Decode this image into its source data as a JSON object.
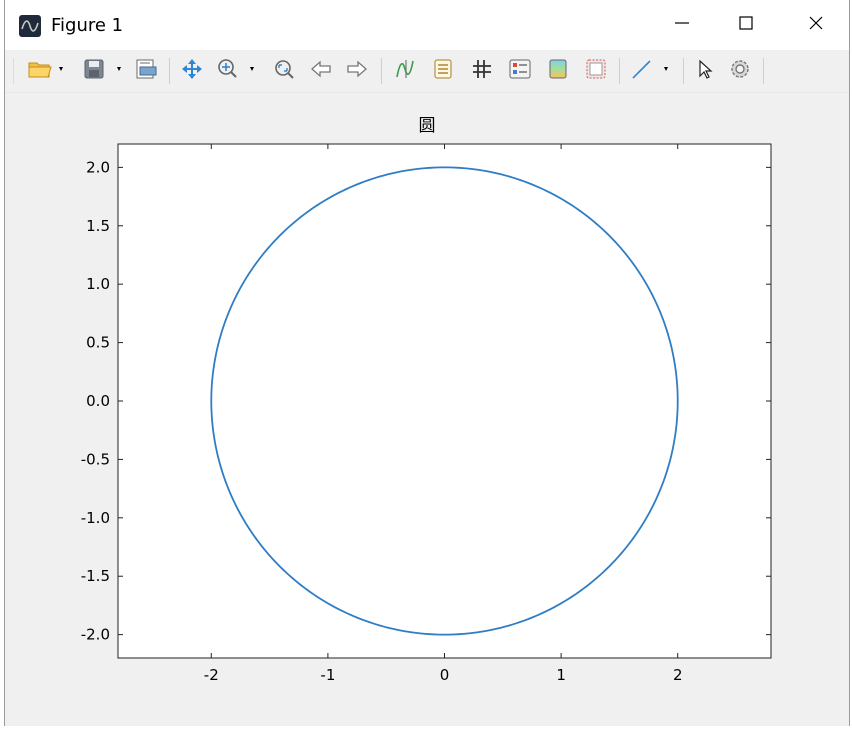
{
  "window": {
    "title": "Figure 1"
  },
  "window_controls": {
    "minimize": "minimize",
    "maximize": "maximize",
    "close": "close"
  },
  "toolbar": {
    "items": [
      "open",
      "save",
      "print-preview",
      "pan",
      "zoom-in",
      "zoom-fit",
      "back",
      "forward",
      "lines",
      "legend",
      "grid",
      "properties",
      "colorbar",
      "frame",
      "line-style",
      "select",
      "settings"
    ]
  },
  "colors": {
    "series": "#2f7dc4",
    "axes": "#000000"
  },
  "chart_data": {
    "type": "line",
    "title": "圆",
    "xlabel": "",
    "ylabel": "",
    "xlim": [
      -2.8,
      2.8
    ],
    "ylim": [
      -2.2,
      2.2
    ],
    "xticks": [
      -2,
      -1,
      0,
      1,
      2
    ],
    "xtick_labels": [
      "-2",
      "-1",
      "0",
      "1",
      "2"
    ],
    "yticks": [
      2.0,
      1.5,
      1.0,
      0.5,
      0.0,
      -0.5,
      -1.0,
      -1.5,
      -2.0
    ],
    "ytick_labels": [
      "2.0",
      "1.5",
      "1.0",
      "0.5",
      "0.0",
      "-0.5",
      "-1.0",
      "-1.5",
      "-2.0"
    ],
    "grid": false,
    "series": [
      {
        "shape": "circle",
        "center": [
          0,
          0
        ],
        "radius": 2
      }
    ]
  }
}
